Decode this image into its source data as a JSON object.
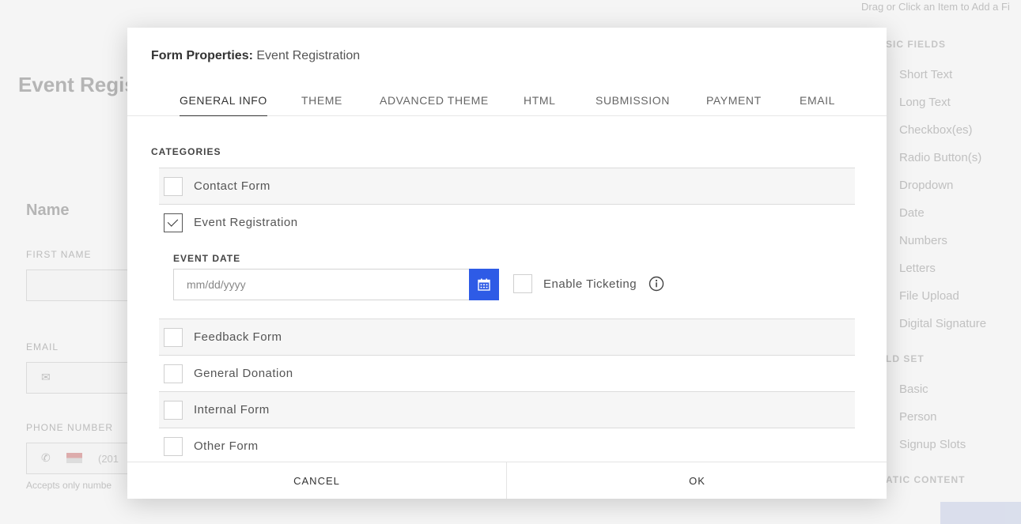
{
  "background": {
    "hint": "Drag or Click an Item to Add a Fi",
    "title": "Event Regis",
    "section": "Name",
    "first_name_label": "FIRST NAME",
    "email_label": "EMAIL",
    "phone_label": "PHONE NUMBER",
    "phone_placeholder": "(201",
    "phone_note": "Accepts only numbe",
    "sidebar": {
      "basic_fields_heading": "SIC FIELDS",
      "items": [
        "Short Text",
        "Long Text",
        "Checkbox(es)",
        "Radio Button(s)",
        "Dropdown",
        "Date",
        "Numbers",
        "Letters",
        "File Upload",
        "Digital Signature"
      ],
      "field_set_heading": "LD SET",
      "field_set_items": [
        "Basic",
        "Person",
        "Signup Slots"
      ],
      "static_heading": "ATIC CONTENT"
    }
  },
  "modal": {
    "title_label": "Form Properties:",
    "title_name": "Event Registration",
    "tabs": [
      "GENERAL INFO",
      "THEME",
      "ADVANCED THEME",
      "HTML",
      "SUBMISSION",
      "PAYMENT",
      "EMAIL"
    ],
    "active_tab": "GENERAL INFO",
    "categories_heading": "CATEGORIES",
    "categories": [
      {
        "label": "Contact Form",
        "checked": false
      },
      {
        "label": "Event Registration",
        "checked": true
      },
      {
        "label": "Feedback Form",
        "checked": false
      },
      {
        "label": "General Donation",
        "checked": false
      },
      {
        "label": "Internal Form",
        "checked": false
      },
      {
        "label": "Other Form",
        "checked": false
      }
    ],
    "event_date": {
      "label": "EVENT DATE",
      "placeholder": "mm/dd/yyyy",
      "value": "",
      "ticketing_label": "Enable Ticketing",
      "ticketing_checked": false
    },
    "footer": {
      "cancel_label": "CANCEL",
      "ok_label": "OK"
    }
  },
  "colors": {
    "accent": "#2e5be6",
    "row_shade": "#f6f6f6",
    "text": "#333333"
  }
}
